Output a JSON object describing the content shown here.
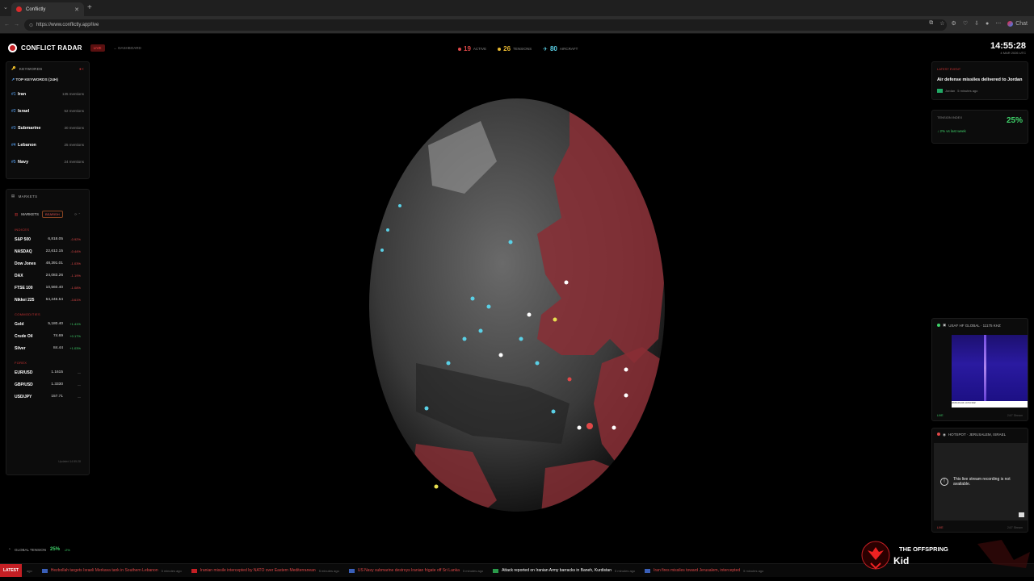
{
  "browser": {
    "tab_title": "Conflictly",
    "url": "https://www.conflictly.app/live",
    "chat_label": "Chat"
  },
  "header": {
    "brand": "CONFLICT RADAR",
    "live_label": "LIVE",
    "dashboard_link": "← DASHBOARD",
    "stats": [
      {
        "value": "19",
        "label": "ACTIVE",
        "color": "#e04848"
      },
      {
        "value": "26",
        "label": "TENSIONS",
        "color": "#e8b830"
      },
      {
        "value": "80",
        "label": "AIRCRAFT",
        "color": "#5ad0e6"
      }
    ],
    "time": "14:55:28",
    "date": "4 MAR 2026 UTC"
  },
  "keywords": {
    "title": "KEYWORDS",
    "subtitle": "TOP KEYWORDS (24H)",
    "items": [
      {
        "rank": "#1",
        "term": "Iran",
        "count": "135 mentions"
      },
      {
        "rank": "#2",
        "term": "Israel",
        "count": "52 mentions"
      },
      {
        "rank": "#3",
        "term": "Submarine",
        "count": "30 mentions"
      },
      {
        "rank": "#4",
        "term": "Lebanon",
        "count": "25 mentions"
      },
      {
        "rank": "#5",
        "term": "Navy",
        "count": "24 mentions"
      }
    ]
  },
  "markets": {
    "title": "MARKETS",
    "sub_title": "MARKETS",
    "badge": "BEARISH",
    "categories": [
      {
        "name": "INDICES",
        "rows": [
          {
            "sym": "S&P 500",
            "val": "6,818.05",
            "chg": "-0.92%",
            "dir": "neg"
          },
          {
            "sym": "NASDAQ",
            "val": "22,612.15",
            "chg": "-0.44%",
            "dir": "neg"
          },
          {
            "sym": "Dow Jones",
            "val": "48,391.01",
            "chg": "-1.03%",
            "dir": "neg"
          },
          {
            "sym": "DAX",
            "val": "24,083.26",
            "chg": "-1.19%",
            "dir": "neg"
          },
          {
            "sym": "FTSE 100",
            "val": "10,560.40",
            "chg": "-1.08%",
            "dir": "neg"
          },
          {
            "sym": "Nikkei 225",
            "val": "54,245.54",
            "chg": "-3.61%",
            "dir": "neg"
          }
        ]
      },
      {
        "name": "COMMODITIES",
        "rows": [
          {
            "sym": "Gold",
            "val": "5,180.40",
            "chg": "+1.41%",
            "dir": "pos"
          },
          {
            "sym": "Crude Oil",
            "val": "74.69",
            "chg": "+0.17%",
            "dir": "pos"
          },
          {
            "sym": "Silver",
            "val": "84.44",
            "chg": "+1.03%",
            "dir": "pos"
          }
        ]
      },
      {
        "name": "FOREX",
        "rows": [
          {
            "sym": "EUR/USD",
            "val": "1.1615",
            "chg": "—",
            "dir": "flat"
          },
          {
            "sym": "GBP/USD",
            "val": "1.3330",
            "chg": "—",
            "dir": "flat"
          },
          {
            "sym": "USD/JPY",
            "val": "157.71",
            "chg": "—",
            "dir": "flat"
          }
        ]
      }
    ],
    "updated": "Updated 14:55:28"
  },
  "right": {
    "latest_tag": "LATEST EVENT",
    "latest_headline": "Air defense missiles delivered to Jordan",
    "latest_place": "Jordan",
    "latest_ago": "5 minutes ago",
    "tension_tag": "TENSION INDEX",
    "tension_pct": "25%",
    "tension_trend": "↓ 2% vs last week",
    "sdr_title": "USAF HF GLOBAL · 11175 KHZ",
    "sdr_status": "LIVE",
    "sdr_stream": "24/7 Stream",
    "sdr_timestamp": "2026-03-04 14:54:39Z",
    "hotspot_title": "HOTSPOT · JERUSALEM, ISRAEL",
    "hotspot_msg": "This live stream recording is not available.",
    "hotspot_status": "LIVE",
    "hotspot_stream": "24/7 Stream"
  },
  "bottom": {
    "tension_label": "GLOBAL TENSION",
    "tension_pct": "25%",
    "tension_delta": "↓2%",
    "ticker_label": "LATEST",
    "ticker_first_ago": "ago",
    "ticker": [
      {
        "text": "Hezbollah targets Israeli Merkava tank in Southern Lebanon",
        "ago": "5 minutes ago",
        "color": "#e04848",
        "flag": "#3a5fb8"
      },
      {
        "text": "Iranian missile intercepted by NATO over Eastern Mediterranean",
        "ago": "5 minutes ago",
        "color": "#e04848",
        "flag": "#c41f24"
      },
      {
        "text": "US Navy submarine destroys Iranian frigate off Sri Lanka",
        "ago": "5 minutes ago",
        "color": "#e04848",
        "flag": "#3a5fb8"
      },
      {
        "text": "Attack reported on Iranian Army barracks in Baneh, Kurdistan",
        "ago": "5 minutes ago",
        "color": "#ffffff",
        "flag": "#2a9a4a"
      },
      {
        "text": "Iran fires missiles toward Jerusalem, intercepted",
        "ago": "5 minutes ago",
        "color": "#e04848",
        "flag": "#3a5fb8"
      }
    ],
    "np_band": "THE OFFSPRING",
    "np_song": "Kid"
  }
}
